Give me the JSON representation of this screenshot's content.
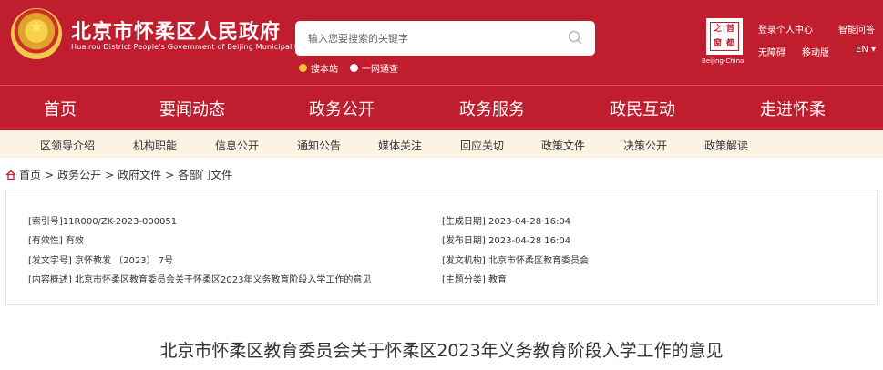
{
  "header": {
    "site_title": "北京市怀柔区人民政府",
    "site_subtitle": "Huairou District People's Government of Beijing Municipality",
    "search": {
      "placeholder": "输入您要搜索的关键字"
    },
    "search_options": [
      "搜本站",
      "一网通查"
    ],
    "seal_chars": [
      "首",
      "都",
      "之",
      "窗"
    ],
    "seal_caption": "Beijing-China",
    "top_links": [
      "登录个人中心",
      "智能问答",
      "无障碍",
      "移动版",
      "EN ▾"
    ]
  },
  "nav": [
    "首页",
    "要闻动态",
    "政务公开",
    "政务服务",
    "政民互动",
    "走进怀柔"
  ],
  "subnav": [
    "区领导介绍",
    "机构职能",
    "信息公开",
    "通知公告",
    "媒体关注",
    "回应关切",
    "政策文件",
    "决策公开",
    "政策解读"
  ],
  "breadcrumb": [
    "首页",
    "政务公开",
    "政府文件",
    "各部门文件"
  ],
  "info_left": [
    "[索引号]11R000/ZK-2023-000051",
    "[有效性] 有效",
    "[发文字号] 京怀教发 〔2023〕 7号",
    "[内容概述] 北京市怀柔区教育委员会关于怀柔区2023年义务教育阶段入学工作的意见"
  ],
  "info_right": [
    "[生成日期] 2023-04-28 16:04",
    "[发布日期] 2023-04-28 16:04",
    "[发文机构] 北京市怀柔区教育委员会",
    "[主题分类] 教育"
  ],
  "doc_title": "北京市怀柔区教育委员会关于怀柔区2023年义务教育阶段入学工作的意见",
  "colors": {
    "brand_red": "#c01e2e",
    "subnav_bg": "#fcf3e4",
    "radio_on": "#f3c33a"
  }
}
